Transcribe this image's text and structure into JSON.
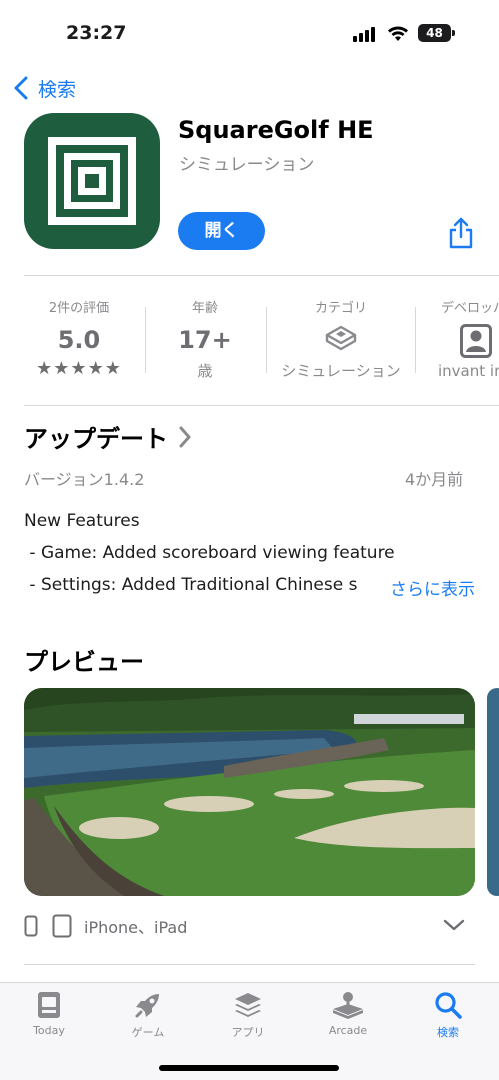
{
  "status": {
    "time": "23:27",
    "battery": "48"
  },
  "nav": {
    "back_label": "検索"
  },
  "app": {
    "name": "SquareGolf HE",
    "category": "シミュレーション",
    "open_label": "開く"
  },
  "info": {
    "ratings": {
      "label": "2件の評価",
      "value": "5.0",
      "stars": "★★★★★"
    },
    "age": {
      "label": "年齢",
      "value": "17+",
      "sub": "歳"
    },
    "category": {
      "label": "カテゴリ",
      "sub": "シミュレーション"
    },
    "developer": {
      "label": "デベロッパ",
      "sub": "invant inc."
    }
  },
  "update": {
    "title": "アップデート",
    "version": "バージョン1.4.2",
    "ago": "4か月前",
    "notes": [
      "New Features",
      " - Game: Added scoreboard viewing feature",
      " - Settings: Added Traditional Chinese s"
    ],
    "more": "さらに表示"
  },
  "preview": {
    "title": "プレビュー",
    "devices": "iPhone、iPad"
  },
  "tabs": [
    {
      "label": "Today",
      "icon": "today-icon"
    },
    {
      "label": "ゲーム",
      "icon": "rocket-icon"
    },
    {
      "label": "アプリ",
      "icon": "layers-icon"
    },
    {
      "label": "Arcade",
      "icon": "joystick-icon"
    },
    {
      "label": "検索",
      "icon": "search-icon",
      "active": true
    }
  ],
  "colors": {
    "accent": "#1a7cf0",
    "icon_bg": "#1f5d3f"
  }
}
